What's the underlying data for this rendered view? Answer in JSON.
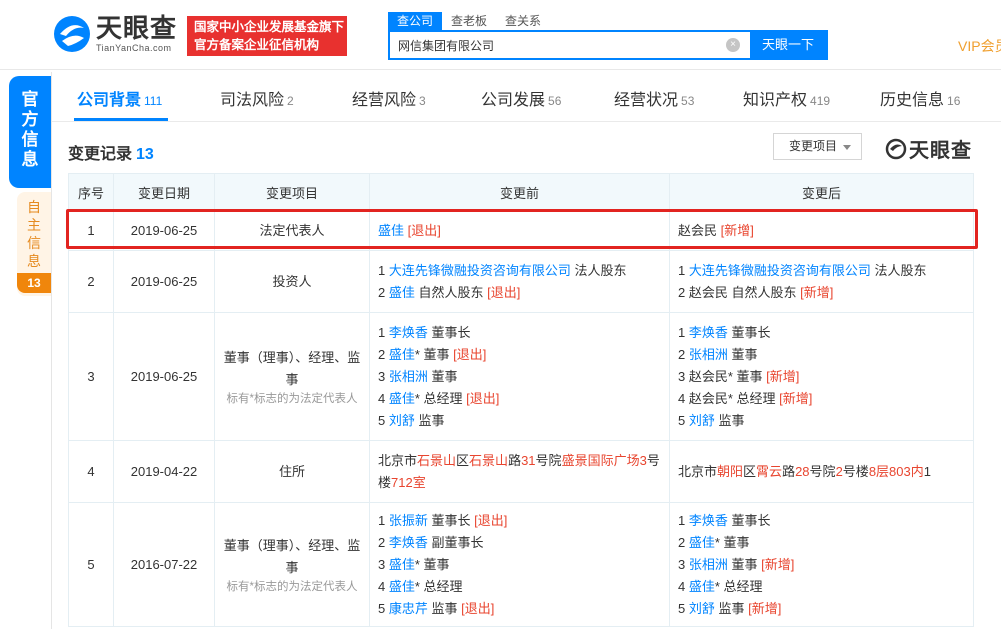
{
  "brand": {
    "name": "天眼查",
    "domain": "TianYanCha.com",
    "slogan_line1": "国家中小企业发展基金旗下",
    "slogan_line2": "官方备案企业征信机构"
  },
  "search": {
    "tabs": [
      "查公司",
      "查老板",
      "查关系"
    ],
    "value": "网信集团有限公司",
    "button": "天眼一下"
  },
  "vip": "VIP会员",
  "side": {
    "official": [
      "官",
      "方",
      "信",
      "息"
    ],
    "self": [
      "自",
      "主",
      "信",
      "息"
    ],
    "self_count": "13"
  },
  "nav": [
    {
      "label": "公司背景",
      "count": "111"
    },
    {
      "label": "司法风险",
      "count": "2"
    },
    {
      "label": "经营风险",
      "count": "3"
    },
    {
      "label": "公司发展",
      "count": "56"
    },
    {
      "label": "经营状况",
      "count": "53"
    },
    {
      "label": "知识产权",
      "count": "419"
    },
    {
      "label": "历史信息",
      "count": "16"
    }
  ],
  "section": {
    "title": "变更记录",
    "count": "13",
    "filter": "变更项目",
    "watermark": "天眼查"
  },
  "table": {
    "headers": [
      "序号",
      "变更日期",
      "变更项目",
      "变更前",
      "变更后"
    ],
    "note": "标有*标志的为法定代表人",
    "rows": [
      {
        "no": "1",
        "date": "2019-06-25",
        "item": "法定代表人",
        "before": [
          [
            {
              "t": "盛佳",
              "s": "link"
            },
            {
              "t": " "
            },
            {
              "t": "[退出]",
              "s": "tag"
            }
          ]
        ],
        "after": [
          [
            {
              "t": "赵会民 "
            },
            {
              "t": "[新增]",
              "s": "tag"
            }
          ]
        ]
      },
      {
        "no": "2",
        "date": "2019-06-25",
        "item": "投资人",
        "before": [
          [
            {
              "t": "1 "
            },
            {
              "t": "大连先锋微融投资咨询有限公司",
              "s": "link"
            },
            {
              "t": " 法人股东"
            }
          ],
          [
            {
              "t": "2 "
            },
            {
              "t": "盛佳",
              "s": "link"
            },
            {
              "t": " 自然人股东 "
            },
            {
              "t": "[退出]",
              "s": "tag"
            }
          ]
        ],
        "after": [
          [
            {
              "t": "1 "
            },
            {
              "t": "大连先锋微融投资咨询有限公司",
              "s": "link"
            },
            {
              "t": " 法人股东"
            }
          ],
          [
            {
              "t": "2 赵会民 自然人股东 "
            },
            {
              "t": "[新增]",
              "s": "tag"
            }
          ]
        ]
      },
      {
        "no": "3",
        "date": "2019-06-25",
        "item": "董事（理事）、经理、监事",
        "has_note": true,
        "before": [
          [
            {
              "t": "1 "
            },
            {
              "t": "李焕香",
              "s": "link"
            },
            {
              "t": " 董事长"
            }
          ],
          [
            {
              "t": "2 "
            },
            {
              "t": "盛佳",
              "s": "link"
            },
            {
              "t": "* 董事 "
            },
            {
              "t": "[退出]",
              "s": "tag"
            }
          ],
          [
            {
              "t": "3 "
            },
            {
              "t": "张相洲",
              "s": "link"
            },
            {
              "t": " 董事"
            }
          ],
          [
            {
              "t": "4 "
            },
            {
              "t": "盛佳",
              "s": "link"
            },
            {
              "t": "* 总经理 "
            },
            {
              "t": "[退出]",
              "s": "tag"
            }
          ],
          [
            {
              "t": "5 "
            },
            {
              "t": "刘舒",
              "s": "link"
            },
            {
              "t": " 监事"
            }
          ]
        ],
        "after": [
          [
            {
              "t": "1 "
            },
            {
              "t": "李焕香",
              "s": "link"
            },
            {
              "t": " 董事长"
            }
          ],
          [
            {
              "t": "2 "
            },
            {
              "t": "张相洲",
              "s": "link"
            },
            {
              "t": " 董事"
            }
          ],
          [
            {
              "t": "3 赵会民* 董事 "
            },
            {
              "t": "[新增]",
              "s": "tag"
            }
          ],
          [
            {
              "t": "4 赵会民* 总经理 "
            },
            {
              "t": "[新增]",
              "s": "tag"
            }
          ],
          [
            {
              "t": "5 "
            },
            {
              "t": "刘舒",
              "s": "link"
            },
            {
              "t": " 监事"
            }
          ]
        ]
      },
      {
        "no": "4",
        "date": "2019-04-22",
        "item": "住所",
        "before": [
          [
            {
              "t": "北京市"
            },
            {
              "t": "石景山",
              "s": "hl"
            },
            {
              "t": "区"
            },
            {
              "t": "石景山",
              "s": "hl"
            },
            {
              "t": "路"
            },
            {
              "t": "31",
              "s": "hl"
            },
            {
              "t": "号院"
            },
            {
              "t": "盛景国际广场",
              "s": "hl"
            },
            {
              "t": "3",
              "s": "hl"
            },
            {
              "t": "号楼"
            },
            {
              "t": "712",
              "s": "hl"
            },
            {
              "t": "室",
              "s": "hl"
            }
          ]
        ],
        "after": [
          [
            {
              "t": "北京市"
            },
            {
              "t": "朝阳",
              "s": "hl"
            },
            {
              "t": "区"
            },
            {
              "t": "霄云",
              "s": "hl"
            },
            {
              "t": "路"
            },
            {
              "t": "28",
              "s": "hl"
            },
            {
              "t": "号院"
            },
            {
              "t": "2",
              "s": "hl"
            },
            {
              "t": "号楼"
            },
            {
              "t": "8层803内",
              "s": "hl"
            },
            {
              "t": "1"
            }
          ]
        ]
      },
      {
        "no": "5",
        "date": "2016-07-22",
        "item": "董事（理事）、经理、监事",
        "has_note": true,
        "before": [
          [
            {
              "t": "1 "
            },
            {
              "t": "张振新",
              "s": "link"
            },
            {
              "t": " 董事长 "
            },
            {
              "t": "[退出]",
              "s": "tag"
            }
          ],
          [
            {
              "t": "2 "
            },
            {
              "t": "李焕香",
              "s": "link"
            },
            {
              "t": " 副董事长"
            }
          ],
          [
            {
              "t": "3 "
            },
            {
              "t": "盛佳",
              "s": "link"
            },
            {
              "t": "* 董事"
            }
          ],
          [
            {
              "t": "4 "
            },
            {
              "t": "盛佳",
              "s": "link"
            },
            {
              "t": "* 总经理"
            }
          ],
          [
            {
              "t": "5 "
            },
            {
              "t": "康忠芹",
              "s": "link"
            },
            {
              "t": " 监事 "
            },
            {
              "t": "[退出]",
              "s": "tag"
            }
          ]
        ],
        "after": [
          [
            {
              "t": "1 "
            },
            {
              "t": "李焕香",
              "s": "link"
            },
            {
              "t": " 董事长"
            }
          ],
          [
            {
              "t": "2 "
            },
            {
              "t": "盛佳",
              "s": "link"
            },
            {
              "t": "* 董事"
            }
          ],
          [
            {
              "t": "3 "
            },
            {
              "t": "张相洲",
              "s": "link"
            },
            {
              "t": " 董事 "
            },
            {
              "t": "[新增]",
              "s": "tag"
            }
          ],
          [
            {
              "t": "4 "
            },
            {
              "t": "盛佳",
              "s": "link"
            },
            {
              "t": "* 总经理"
            }
          ],
          [
            {
              "t": "5 "
            },
            {
              "t": "刘舒",
              "s": "link"
            },
            {
              "t": " 监事 "
            },
            {
              "t": "[新增]",
              "s": "tag"
            }
          ]
        ]
      }
    ]
  },
  "colors": {
    "brand_blue": "#0084ff",
    "tag_red": "#e8452f",
    "vip_orange": "#f0a030",
    "highlight_red": "#e22420"
  }
}
